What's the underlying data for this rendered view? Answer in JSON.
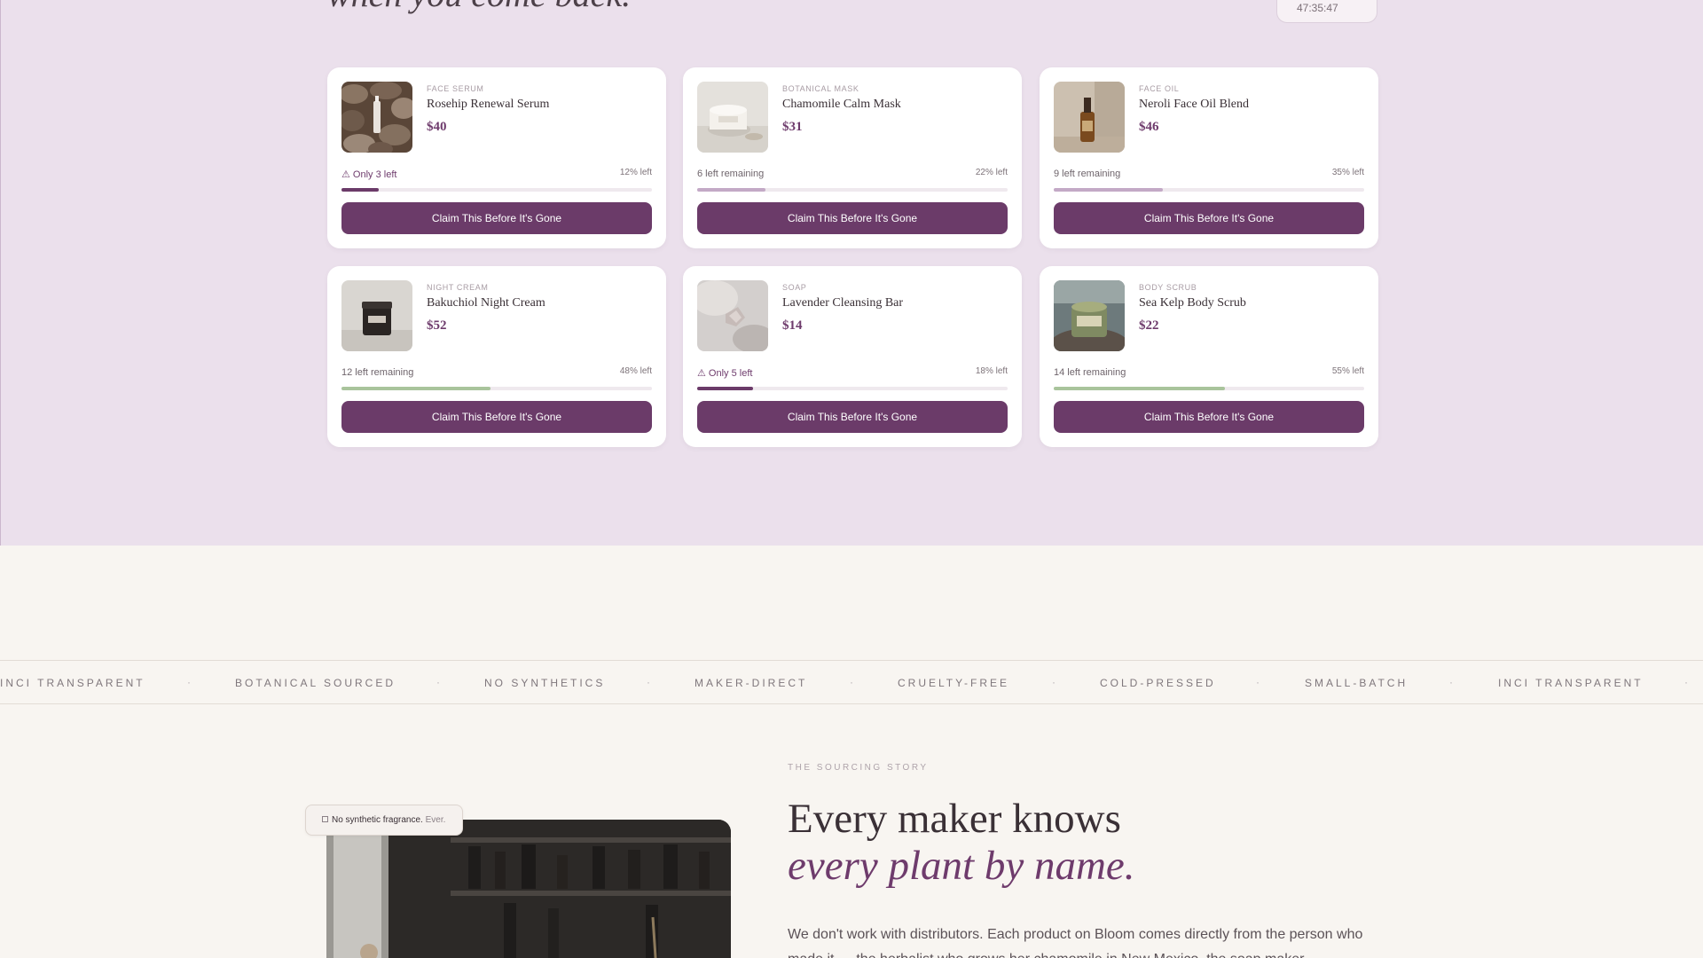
{
  "hero": {
    "title": "when you come back.",
    "timer": "47:35:47"
  },
  "products": [
    {
      "category": "FACE SERUM",
      "name": "Rosehip Renewal Serum",
      "price": "$40",
      "stock": "⚠ Only 3 left",
      "pct": "12% left",
      "level": 0.12,
      "warn": true,
      "cta": "Claim This Before It's Gone",
      "bar_color": "#6b3b69"
    },
    {
      "category": "BOTANICAL MASK",
      "name": "Chamomile Calm Mask",
      "price": "$31",
      "stock": "6 left remaining",
      "pct": "22% left",
      "level": 0.22,
      "warn": false,
      "cta": "Claim This Before It's Gone",
      "bar_color": "#c3a9c6"
    },
    {
      "category": "FACE OIL",
      "name": "Neroli Face Oil Blend",
      "price": "$46",
      "stock": "9 left remaining",
      "pct": "35% left",
      "level": 0.35,
      "warn": false,
      "cta": "Claim This Before It's Gone",
      "bar_color": "#c3a9c6"
    },
    {
      "category": "NIGHT CREAM",
      "name": "Bakuchiol Night Cream",
      "price": "$52",
      "stock": "12 left remaining",
      "pct": "48% left",
      "level": 0.48,
      "warn": false,
      "cta": "Claim This Before It's Gone",
      "bar_color": "#a9c49c"
    },
    {
      "category": "SOAP",
      "name": "Lavender Cleansing Bar",
      "price": "$14",
      "stock": "⚠ Only 5 left",
      "pct": "18% left",
      "level": 0.18,
      "warn": true,
      "cta": "Claim This Before It's Gone",
      "bar_color": "#6b3b69"
    },
    {
      "category": "BODY SCRUB",
      "name": "Sea Kelp Body Scrub",
      "price": "$22",
      "stock": "14 left remaining",
      "pct": "55% left",
      "level": 0.55,
      "warn": false,
      "cta": "Claim This Before It's Gone",
      "bar_color": "#a9c49c"
    }
  ],
  "marquee": [
    "INCI TRANSPARENT",
    "BOTANICAL SOURCED",
    "NO SYNTHETICS",
    "MAKER-DIRECT",
    "CRUELTY-FREE",
    "COLD-PRESSED",
    "SMALL-BATCH",
    "INCI TRANSPARENT"
  ],
  "marquee_separator": "·",
  "story": {
    "badge": "No synthetic fragrance.",
    "badge_suffix": "Ever.",
    "badge_icon": "checkbox-icon",
    "eyebrow": "THE SOURCING STORY",
    "heading_line1": "Every maker knows",
    "heading_line2": "every plant by name.",
    "body": "We don't work with distributors. Each product on Bloom comes directly from the person who made it — the herbalist who grows her chamomile in New Mexico, the soap maker"
  },
  "colors": {
    "accent": "#6b3b69",
    "hero_bg": "#ebe0ec",
    "page_bg": "#f8f5f1"
  }
}
